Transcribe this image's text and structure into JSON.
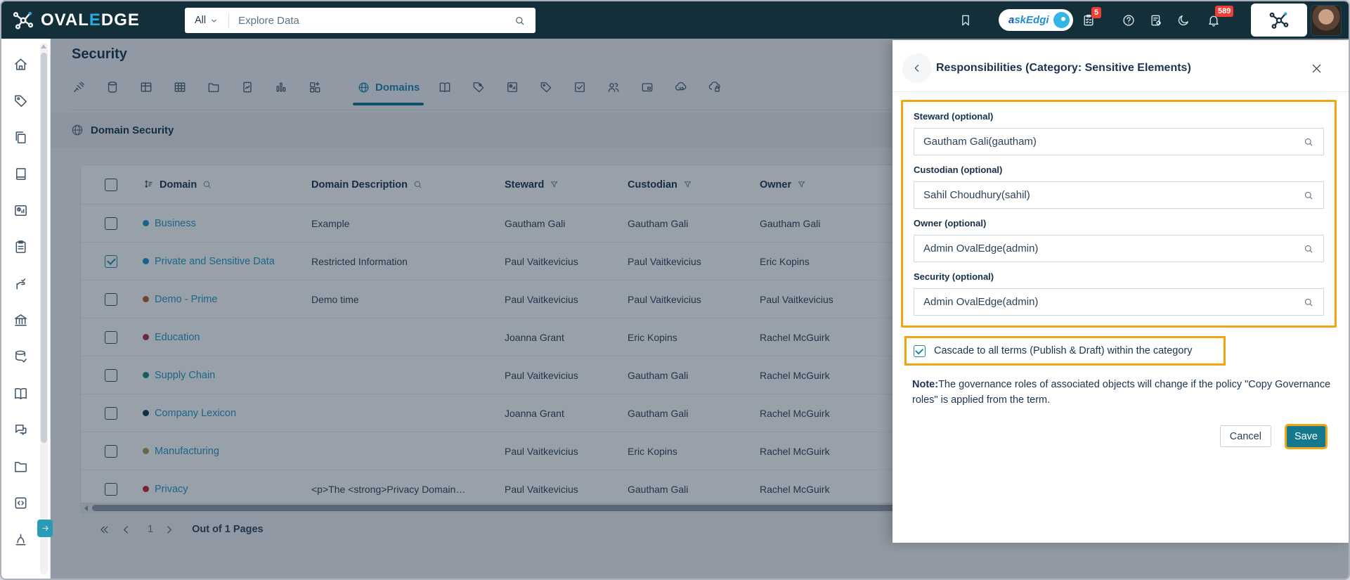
{
  "topbar": {
    "brand": {
      "prefix": "OVAL",
      "accent": "E",
      "suffix": "DGE",
      "logo_icon": "network"
    },
    "search": {
      "scope": "All",
      "placeholder": "Explore Data",
      "icons": [
        "caret-down",
        "search"
      ]
    },
    "ask_button": {
      "label_accent": "a",
      "label_rest": "skEdgi",
      "icon": "robot"
    },
    "icons": [
      "bookmark",
      "task-clipboard",
      "help",
      "doc-gear",
      "moon",
      "bell"
    ],
    "badges": {
      "tasks": "5",
      "notifications": "589"
    }
  },
  "sidebar": {
    "items": [
      {
        "name": "home",
        "icon": "home"
      },
      {
        "name": "tags",
        "icon": "tag"
      },
      {
        "name": "literature",
        "icon": "copy"
      },
      {
        "name": "catalog",
        "icon": "book"
      },
      {
        "name": "reports",
        "icon": "report"
      },
      {
        "name": "projects",
        "icon": "clipboard"
      },
      {
        "name": "endorsements",
        "icon": "endorse"
      },
      {
        "name": "governance",
        "icon": "bank"
      },
      {
        "name": "data-quality",
        "icon": "db-check"
      },
      {
        "name": "glossary",
        "icon": "open-book"
      },
      {
        "name": "collaboration",
        "icon": "chat"
      },
      {
        "name": "files",
        "icon": "folder"
      },
      {
        "name": "query-sheet",
        "icon": "code-box"
      },
      {
        "name": "jobs",
        "icon": "tree"
      }
    ],
    "expand_icon": "arrow-right"
  },
  "main": {
    "page_title": "Security",
    "tabs": [
      {
        "icon": "plug"
      },
      {
        "icon": "database"
      },
      {
        "icon": "table"
      },
      {
        "icon": "grid"
      },
      {
        "icon": "folder"
      },
      {
        "icon": "file-chart"
      },
      {
        "icon": "bar-chart"
      },
      {
        "icon": "blocks"
      },
      {
        "icon": "globe",
        "label": "Domains",
        "active": true
      },
      {
        "icon": "open-book"
      },
      {
        "icon": "tag-user"
      },
      {
        "icon": "report-sm"
      },
      {
        "icon": "tag"
      },
      {
        "icon": "checkbox"
      },
      {
        "icon": "users"
      },
      {
        "icon": "card"
      },
      {
        "icon": "cloud-api"
      },
      {
        "icon": "cloud-lock"
      }
    ],
    "section": {
      "title": "Domain Security",
      "icon": "globe"
    },
    "table": {
      "columns": [
        {
          "label": "Domain",
          "sort": true,
          "search": true
        },
        {
          "label": "Domain Description",
          "search": true
        },
        {
          "label": "Steward",
          "filter": true
        },
        {
          "label": "Custodian",
          "filter": true
        },
        {
          "label": "Owner",
          "filter": true
        }
      ],
      "rows": [
        {
          "name": "Business",
          "dot_color": "#2196c9",
          "description": "Example",
          "steward": "Gautham Gali",
          "custodian": "Gautham Gali",
          "owner": "Gautham Gali",
          "checked": false
        },
        {
          "name": "Private and Sensitive Data",
          "dot_color": "#2196c9",
          "description": "Restricted Information",
          "steward": "Paul Vaitkevicius",
          "custodian": "Paul Vaitkevicius",
          "owner": "Eric Kopins",
          "checked": true
        },
        {
          "name": "Demo - Prime",
          "dot_color": "#c2632c",
          "description": "Demo time",
          "steward": "Paul Vaitkevicius",
          "custodian": "Paul Vaitkevicius",
          "owner": "Paul Vaitkevicius",
          "checked": false
        },
        {
          "name": "Education",
          "dot_color": "#b13253",
          "description": "",
          "steward": "Joanna Grant",
          "custodian": "Eric Kopins",
          "owner": "Rachel McGuirk",
          "checked": false
        },
        {
          "name": "Supply Chain",
          "dot_color": "#21907f",
          "description": "",
          "steward": "Paul Vaitkevicius",
          "custodian": "Gautham Gali",
          "owner": "Rachel McGuirk",
          "checked": false
        },
        {
          "name": "Company Lexicon",
          "dot_color": "#1d3d4d",
          "description": "",
          "steward": "Joanna Grant",
          "custodian": "Gautham Gali",
          "owner": "Rachel McGuirk",
          "checked": false
        },
        {
          "name": "Manufacturing",
          "dot_color": "#ac9f55",
          "description": "",
          "steward": "Paul Vaitkevicius",
          "custodian": "Eric Kopins",
          "owner": "Rachel McGuirk",
          "checked": false
        },
        {
          "name": "Privacy",
          "dot_color": "#cc2936",
          "description": "<p>The <strong>Privacy Domain…",
          "steward": "Paul Vaitkevicius",
          "custodian": "Gautham Gali",
          "owner": "Rachel McGuirk",
          "checked": false
        }
      ]
    },
    "pagination": {
      "page": "1",
      "label": "Out of 1 Pages",
      "icons": [
        "chevrons-left",
        "chevron-left",
        "chevron-right"
      ]
    }
  },
  "drawer": {
    "back_icon": "chevron-left",
    "title": "Responsibilities (Category: Sensitive Elements)",
    "close_icon": "close",
    "fields": [
      {
        "label": "Steward (optional)",
        "value": "Gautham Gali(gautham)",
        "icon": "search"
      },
      {
        "label": "Custodian (optional)",
        "value": "Sahil Choudhury(sahil)",
        "icon": "search"
      },
      {
        "label": "Owner (optional)",
        "value": "Admin OvalEdge(admin)",
        "icon": "search"
      },
      {
        "label": "Security (optional)",
        "value": "Admin OvalEdge(admin)",
        "icon": "search"
      }
    ],
    "cascade": {
      "label": "Cascade to all terms (Publish & Draft) within the category",
      "checked": true
    },
    "note_prefix": "Note:",
    "note_text": "The governance roles of associated objects will change if the policy \"Copy Governance roles\" is applied from the term.",
    "cancel_label": "Cancel",
    "save_label": "Save",
    "highlight_color": "#f2a513",
    "save_color": "#15798d"
  },
  "colors": {
    "topbar_bg": "#132f3a",
    "accent_blue": "#2aa9dc",
    "active_tab": "#2089b4",
    "link": "#2b9cc7",
    "badge_red": "#ef3e33",
    "highlight_orange": "#f2a513",
    "save_teal": "#15798d"
  }
}
